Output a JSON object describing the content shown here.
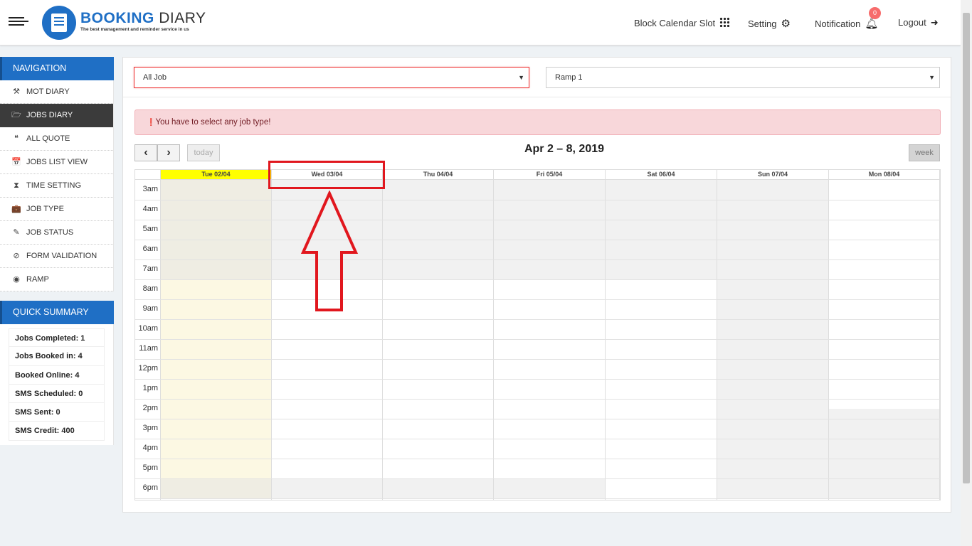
{
  "header": {
    "logo_brand": "BOOKING",
    "logo_product": "DIARY",
    "logo_tagline": "The best management and reminder service in us",
    "block_calendar_slot": "Block Calendar Slot",
    "setting": "Setting",
    "notification": "Notification",
    "notification_count": "0",
    "logout": "Logout"
  },
  "sidebar": {
    "navigation_title": "NAVIGATION",
    "items": [
      {
        "label": "MOT DIARY",
        "icon": "tools-icon",
        "glyph": "⚒"
      },
      {
        "label": "JOBS DIARY",
        "icon": "folder-open-icon",
        "glyph": "🗁",
        "active": true
      },
      {
        "label": "ALL QUOTE",
        "icon": "quote-icon",
        "glyph": "❝"
      },
      {
        "label": "JOBS LIST VIEW",
        "icon": "calendar-check-icon",
        "glyph": "📅"
      },
      {
        "label": "TIME SETTING",
        "icon": "hourglass-icon",
        "glyph": "⧗"
      },
      {
        "label": "JOB TYPE",
        "icon": "briefcase-icon",
        "glyph": "💼"
      },
      {
        "label": "JOB STATUS",
        "icon": "edit-icon",
        "glyph": "✎"
      },
      {
        "label": "FORM VALIDATION",
        "icon": "ban-icon",
        "glyph": "⊘"
      },
      {
        "label": "RAMP",
        "icon": "compass-icon",
        "glyph": "◉"
      }
    ],
    "quick_summary_title": "QUICK SUMMARY",
    "summary": [
      "Jobs Completed: 1",
      "Jobs Booked in: 4",
      "Booked Online: 4",
      "SMS Scheduled: 0",
      "SMS Sent: 0",
      "SMS Credit: 400"
    ]
  },
  "filters": {
    "job_select": "All Job",
    "ramp_select": "Ramp 1"
  },
  "alert": {
    "message": "You have to select any job type!"
  },
  "calendar": {
    "prev_label": "‹",
    "next_label": "›",
    "today_label": "today",
    "view_label": "week",
    "title": "Apr 2 – 8, 2019",
    "days": [
      "Tue 02/04",
      "Wed 03/04",
      "Thu 04/04",
      "Fri 05/04",
      "Sat 06/04",
      "Sun 07/04",
      "Mon 08/04"
    ],
    "times": [
      "3am",
      "4am",
      "5am",
      "6am",
      "7am",
      "8am",
      "9am",
      "10am",
      "11am",
      "12pm",
      "1pm",
      "2pm",
      "3pm",
      "4pm",
      "5pm",
      "6pm"
    ],
    "today_highlight_color": "#ffff00"
  },
  "colors": {
    "brand_blue": "#1f6fc5",
    "annotation_red": "#e1171e",
    "alert_bg": "#f8d7da"
  }
}
